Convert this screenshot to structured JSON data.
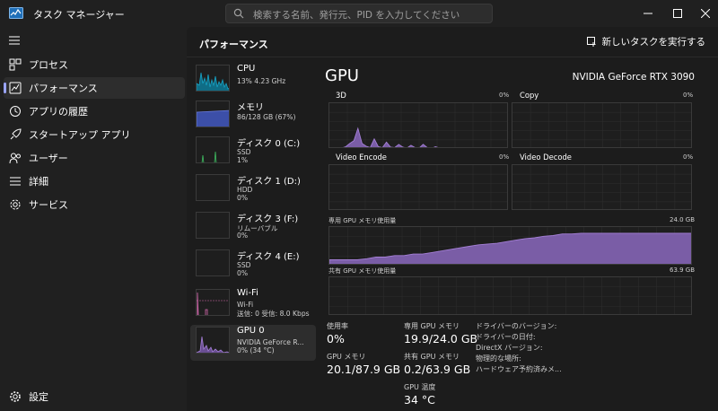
{
  "window": {
    "title": "タスク マネージャー",
    "search_placeholder": "検索する名前、発行元、PID を入力してください",
    "buttons": [
      "minimize",
      "maximize",
      "close"
    ]
  },
  "sidebar": {
    "items": [
      {
        "label": "プロセス",
        "icon": "processes-icon"
      },
      {
        "label": "パフォーマンス",
        "icon": "performance-icon",
        "active": true
      },
      {
        "label": "アプリの履歴",
        "icon": "history-icon"
      },
      {
        "label": "スタートアップ アプリ",
        "icon": "startup-icon"
      },
      {
        "label": "ユーザー",
        "icon": "users-icon"
      },
      {
        "label": "詳細",
        "icon": "details-icon"
      },
      {
        "label": "サービス",
        "icon": "services-icon"
      }
    ],
    "settings_label": "設定"
  },
  "header": {
    "title": "パフォーマンス",
    "run_task_label": "新しいタスクを実行する"
  },
  "devices": [
    {
      "name": "CPU",
      "sub1": "13%  4.23 GHz",
      "sub2": "",
      "color": "#17a2c4"
    },
    {
      "name": "メモリ",
      "sub1": "86/128 GB (67%)",
      "sub2": "",
      "color": "#6b7de0"
    },
    {
      "name": "ディスク 0 (C:)",
      "sub1": "SSD",
      "sub2": "1%",
      "color": "#3fbf62"
    },
    {
      "name": "ディスク 1 (D:)",
      "sub1": "HDD",
      "sub2": "0%",
      "color": "#3fbf62"
    },
    {
      "name": "ディスク 3 (F:)",
      "sub1": "リムーバブル",
      "sub2": "0%",
      "color": "#3fbf62"
    },
    {
      "name": "ディスク 4 (E:)",
      "sub1": "SSD",
      "sub2": "0%",
      "color": "#3fbf62"
    },
    {
      "name": "Wi-Fi",
      "sub1": "Wi-Fi",
      "sub2": "送信: 0 受信: 8.0 Kbps",
      "color": "#d66ab0"
    },
    {
      "name": "GPU 0",
      "sub1": "NVIDIA GeForce R...",
      "sub2": "0% (34 °C)",
      "color": "#a47fd6",
      "active": true
    }
  ],
  "gpu": {
    "title": "GPU",
    "model": "NVIDIA GeForce RTX 3090",
    "engines": [
      {
        "name": "3D",
        "pct": "0%",
        "points": [
          0,
          0,
          0,
          2,
          5,
          12,
          18,
          45,
          12,
          6,
          3,
          22,
          5,
          3,
          15,
          4,
          3,
          10,
          4,
          2,
          8,
          3,
          2,
          10,
          3,
          1,
          5,
          2,
          1,
          3,
          1,
          0,
          1,
          1,
          0,
          3,
          1,
          0,
          1,
          0,
          0,
          1,
          0,
          0,
          0
        ]
      },
      {
        "name": "Copy",
        "pct": "0%",
        "points": [
          0,
          0,
          0,
          0,
          0,
          0,
          2,
          0,
          2,
          0,
          2,
          0,
          2,
          0,
          3,
          0,
          2,
          0,
          2,
          0,
          2,
          0,
          2,
          0,
          2,
          0,
          2,
          0,
          3,
          0,
          2,
          0,
          2,
          0,
          1,
          0,
          1,
          0,
          0
        ]
      },
      {
        "name": "Video Encode",
        "pct": "0%"
      },
      {
        "name": "Video Decode",
        "pct": "0%"
      }
    ],
    "dedicated_mem_label": "専用 GPU メモリ使用量",
    "dedicated_mem_max": "24.0 GB",
    "dedicated_mem_points": [
      15,
      15,
      15,
      15,
      18,
      22,
      22,
      26,
      26,
      30,
      30,
      34,
      38,
      42,
      46,
      50,
      54,
      56,
      58,
      62,
      66,
      70,
      72,
      76,
      78,
      82,
      82,
      84,
      84,
      84,
      84,
      84,
      84,
      84,
      84,
      84,
      84,
      84,
      84,
      84
    ],
    "shared_mem_label": "共有 GPU メモリ使用量",
    "shared_mem_max": "63.9 GB",
    "stats": {
      "util_label": "使用率",
      "util_value": "0%",
      "gpu_mem_label": "GPU メモリ",
      "gpu_mem_value": "20.1/87.9 GB",
      "dedicated_label": "専用 GPU メモリ",
      "dedicated_value": "19.9/24.0 GB",
      "shared_label": "共有 GPU メモリ",
      "shared_value": "0.2/63.9 GB",
      "temp_label": "GPU 温度",
      "temp_value": "34 °C"
    },
    "info": [
      "ドライバーのバージョン:",
      "ドライバーの日付:",
      "DirectX バージョン:",
      "物理的な場所:",
      "ハードウェア予約済みメ..."
    ]
  },
  "colors": {
    "gpu_line": "#a47fd6",
    "gpu_fill": "#7a5da6",
    "accent": "#9aa4ff"
  }
}
